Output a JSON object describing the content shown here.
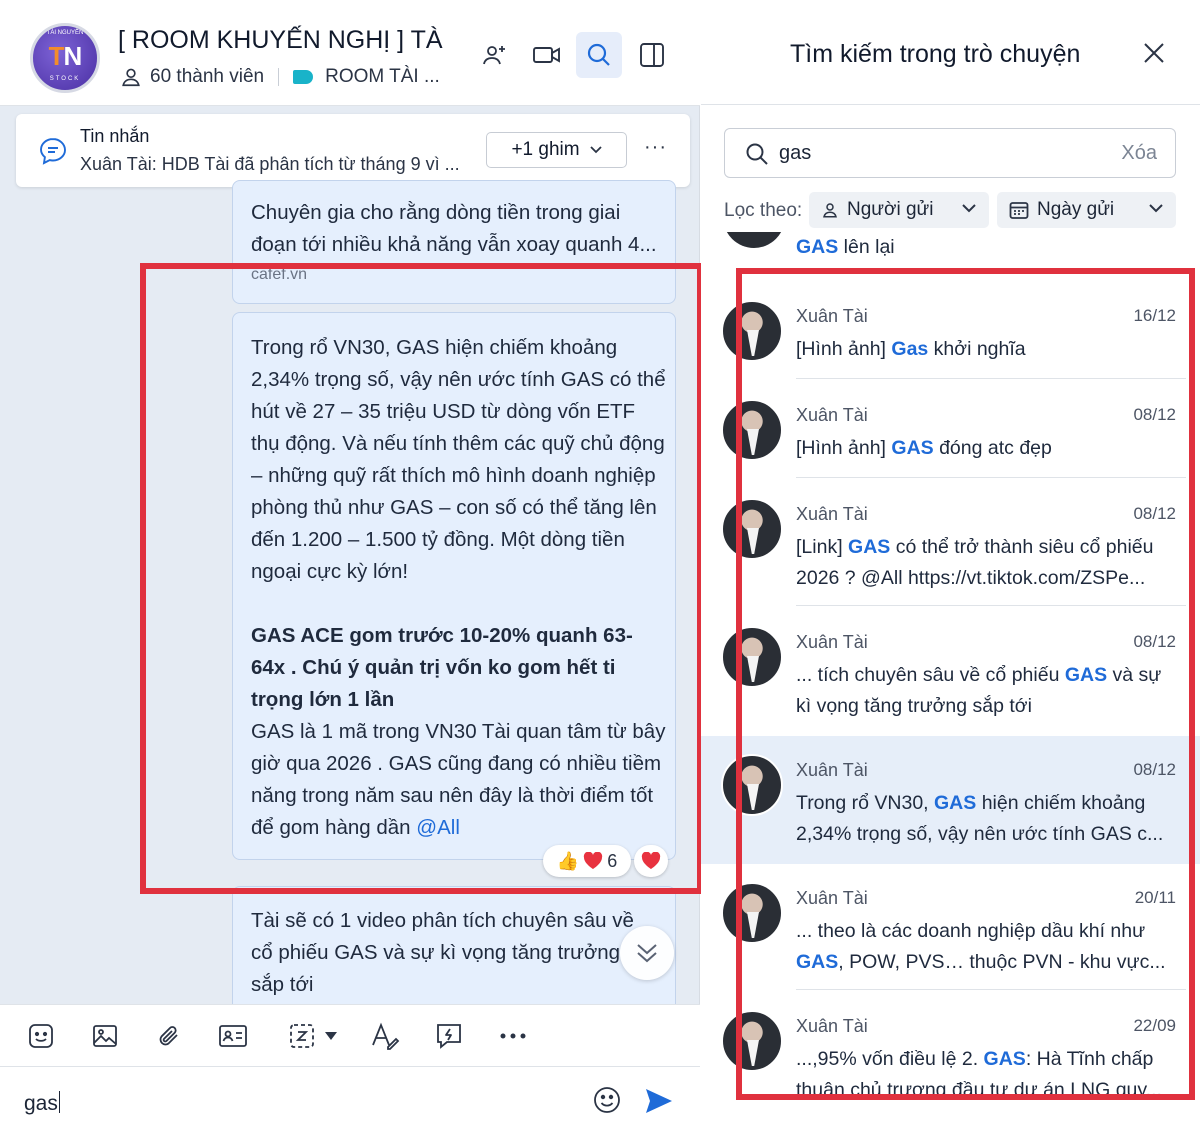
{
  "colors": {
    "accent": "#1f6bd8",
    "highlight_box": "#e0313e",
    "bubble_bg": "#e5effd",
    "tag": "#19b3c9"
  },
  "chat": {
    "avatar": {
      "small_text": "TÀI NGUYỄN",
      "initials_1": "T",
      "initials_2": "N",
      "stock_text": "STOCK"
    },
    "title": "[ ROOM KHUYẾN NGHỊ ] TÀ",
    "member_count": "60 thành viên",
    "tag_label": "ROOM TÀI ...",
    "header_icons": [
      "add-member-icon",
      "video-call-icon",
      "search-icon",
      "sidebar-toggle-icon"
    ]
  },
  "pinned": {
    "title": "Tin nhắn",
    "text": "Xuân Tài: HDB Tài đã phân tích từ tháng 9 vì ...",
    "pin_button": "+1 ghim",
    "more": "···"
  },
  "messages": {
    "top_text": "Chuyên gia cho rằng dòng tiền trong giai đoạn tới nhiều khả năng vẫn xoay quanh 4...",
    "top_source": "cafef.vn",
    "main_paragraph": "Trong rổ VN30, GAS hiện chiếm khoảng 2,34% trọng số, vậy nên ước tính GAS có thể hút về 27 – 35 triệu USD từ dòng vốn ETF thụ động. Và nếu tính thêm các quỹ chủ động – những quỹ rất thích mô hình doanh nghiệp phòng thủ như GAS – con số có thể tăng lên đến 1.200 – 1.500 tỷ đồng. Một dòng tiền ngoại cực kỳ lớn!",
    "main_bold": "GAS ACE gom trước 10-20% quanh 63-64x . Chú ý quản trị vốn ko gom hết ti trọng lớn 1 lần",
    "main_paragraph2": "GAS là 1 mã trong VN30 Tài quan tâm từ bây giờ qua 2026 . GAS cũng đang có nhiều tiềm năng trong năm sau nên đây là thời điểm tốt để gom hàng dần ",
    "mention": "@All",
    "reaction_count": "6",
    "bottom_text": "Tài sẽ có 1 video phân tích chuyên sâu về cổ phiếu GAS và sự kì vọng tăng trưởng sắp tới"
  },
  "composer": {
    "value": "gas"
  },
  "search": {
    "title": "Tìm kiếm trong trò chuyện",
    "query": "gas",
    "clear_label": "Xóa",
    "filter_label": "Lọc theo:",
    "filter_sender": "Người gửi",
    "filter_date": "Ngày gửi",
    "partial_top": {
      "hl": "GAS",
      "rest": " lên lại"
    },
    "results": [
      {
        "sender": "Xuân Tài",
        "date": "16/12",
        "pre": "[Hình ảnh] ",
        "hl": "Gas",
        "post": " khởi nghĩa"
      },
      {
        "sender": "Xuân Tài",
        "date": "08/12",
        "pre": "[Hình ảnh] ",
        "hl": "GAS",
        "post": " đóng atc đẹp"
      },
      {
        "sender": "Xuân Tài",
        "date": "08/12",
        "pre": "[Link] ",
        "hl": "GAS",
        "post": " có thể trở thành siêu cổ phiếu 2026 ? @All https://vt.tiktok.com/ZSPe..."
      },
      {
        "sender": "Xuân Tài",
        "date": "08/12",
        "pre": "... tích chuyên sâu về cổ phiếu ",
        "hl": "GAS",
        "post": " và sự kì vọng tăng trưởng sắp tới"
      },
      {
        "sender": "Xuân Tài",
        "date": "08/12",
        "pre": "Trong rổ VN30, ",
        "hl": "GAS",
        "post": " hiện chiếm khoảng 2,34% trọng số, vậy nên ước tính GAS c..."
      },
      {
        "sender": "Xuân Tài",
        "date": "20/11",
        "pre": "... theo là các doanh nghiệp dầu khí như ",
        "hl": "GAS",
        "post": ", POW, PVS… thuộc PVN - khu vực..."
      },
      {
        "sender": "Xuân Tài",
        "date": "22/09",
        "pre": "...,95% vốn điều lệ 2. ",
        "hl": "GAS",
        "post": ": Hà Tĩnh chấp thuận chủ trương đầu tư dự án LNG quy..."
      }
    ]
  }
}
